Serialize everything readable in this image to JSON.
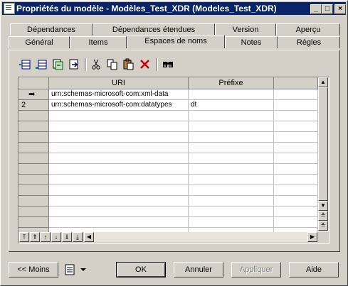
{
  "window": {
    "title": "Propriétés du modèle - Modèles_Test_XDR (Modeles_Test_XDR)"
  },
  "titlebar_buttons": {
    "minimize": "_",
    "maximize": "□",
    "close": "×"
  },
  "tabs_back": [
    "Dépendances",
    "Dépendances étendues",
    "Version",
    "Aperçu"
  ],
  "tabs_front": [
    "Général",
    "Items",
    "Espaces de noms",
    "Notes",
    "Règles"
  ],
  "active_tab": "Espaces de noms",
  "toolbar": {
    "icons": [
      "insert-row-icon",
      "add-row-icon",
      "add-objects-icon",
      "import-icon",
      "cut-icon",
      "copy-icon",
      "paste-icon",
      "delete-icon",
      "find-icon"
    ]
  },
  "grid": {
    "columns": [
      "URI",
      "Préfixe"
    ],
    "rows": [
      {
        "marker": "➡",
        "uri": "urn:schemas-microsoft-com:xml-data",
        "prefix": ""
      },
      {
        "marker": "2",
        "uri": "urn:schemas-microsoft-com:datatypes",
        "prefix": "dt"
      }
    ],
    "empty_rows": 13
  },
  "buttons": {
    "less": "<< Moins",
    "ok": "OK",
    "cancel": "Annuler",
    "apply": "Appliquer",
    "help": "Aide"
  }
}
